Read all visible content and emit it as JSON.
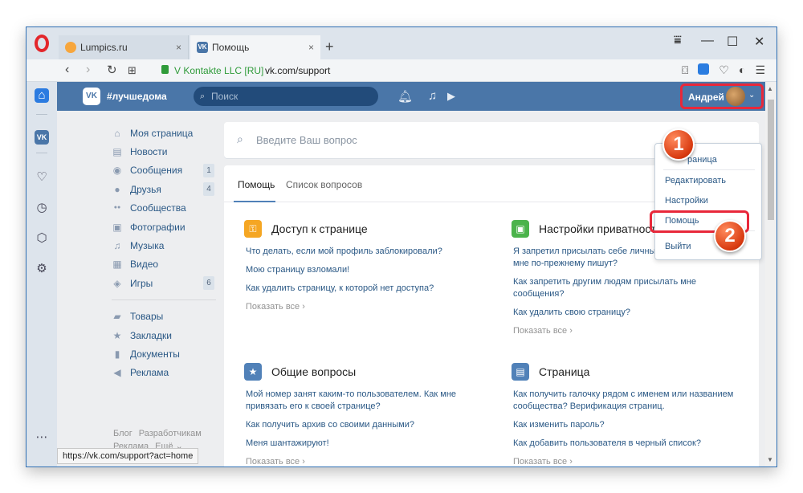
{
  "browser": {
    "tabs": [
      {
        "title": "Lumpics.ru",
        "close": "×"
      },
      {
        "title": "Помощь",
        "close": "×"
      }
    ],
    "new_tab": "+",
    "window_controls": [
      "⩸",
      "—",
      "☐",
      "✕"
    ],
    "cert": "V Kontakte LLC [RU]",
    "url": "vk.com/support",
    "status_url": "https://vk.com/support?act=home"
  },
  "vk": {
    "logo": "VK",
    "header_title": "#лучшедома",
    "search_placeholder": "Поиск",
    "user_name": "Андрей"
  },
  "left_menu": [
    {
      "label": "Моя страница",
      "icon": "home-icon",
      "glyph": "⌂"
    },
    {
      "label": "Новости",
      "icon": "news-icon",
      "glyph": "▤"
    },
    {
      "label": "Сообщения",
      "icon": "messages-icon",
      "glyph": "◉",
      "count": "1"
    },
    {
      "label": "Друзья",
      "icon": "friends-icon",
      "glyph": "●",
      "count": "4"
    },
    {
      "label": "Сообщества",
      "icon": "groups-icon",
      "glyph": "●●"
    },
    {
      "label": "Фотографии",
      "icon": "photos-icon",
      "glyph": "▣"
    },
    {
      "label": "Музыка",
      "icon": "music-icon",
      "glyph": "♫"
    },
    {
      "label": "Видео",
      "icon": "video-icon",
      "glyph": "▦"
    },
    {
      "label": "Игры",
      "icon": "games-icon",
      "glyph": "◈",
      "count": "6"
    }
  ],
  "left_menu_2": [
    {
      "label": "Товары",
      "icon": "goods-icon",
      "glyph": "▰"
    },
    {
      "label": "Закладки",
      "icon": "bookmarks-icon",
      "glyph": "★"
    },
    {
      "label": "Документы",
      "icon": "documents-icon",
      "glyph": "▮"
    },
    {
      "label": "Реклама",
      "icon": "ads-icon",
      "glyph": "◀"
    }
  ],
  "footer": {
    "row1": [
      "Блог",
      "Разработчикам"
    ],
    "row2": [
      "Реклама",
      "Ещё ⌄"
    ]
  },
  "support": {
    "search_placeholder": "Введите Ваш вопрос",
    "tabs": [
      "Помощь",
      "Список вопросов"
    ],
    "more_label": "Показать все ›",
    "sections": [
      {
        "title": "Доступ к странице",
        "color": "#f5a623",
        "glyph": "🔑",
        "links": [
          "Что делать, если мой профиль заблокировали?",
          "Мою страницу взломали!",
          "Как удалить страницу, к которой нет доступа?"
        ]
      },
      {
        "title": "Настройки приватност",
        "color": "#4bb34b",
        "glyph": "🔒",
        "links": [
          "Я запретил присылать себе личные сообщения, почему мне по-прежнему пишут?",
          "Как запретить другим людям присылать мне сообщения?",
          "Как удалить свою страницу?"
        ]
      },
      {
        "title": "Общие вопросы",
        "color": "#5181b8",
        "glyph": "★",
        "links": [
          "Мой номер занят каким-то пользователем. Как мне привязать его к своей странице?",
          "Как получить архив со своими данными?",
          "Меня шантажируют!"
        ]
      },
      {
        "title": "Страница",
        "color": "#5181b8",
        "glyph": "▤",
        "links": [
          "Как получить галочку рядом с именем или названием сообщества? Верификация страниц.",
          "Как изменить пароль?",
          "Как добавить пользователя в черный список?"
        ]
      }
    ]
  },
  "dropdown": {
    "items": [
      "раница",
      "Редактировать",
      "Настройки",
      "Помощь",
      "Выйти"
    ]
  },
  "badges": [
    "1",
    "2"
  ],
  "colors": {
    "vk_blue": "#4a76a8",
    "link": "#2a5885",
    "highlight": "#e8283a",
    "opera_red": "#e3262b"
  }
}
